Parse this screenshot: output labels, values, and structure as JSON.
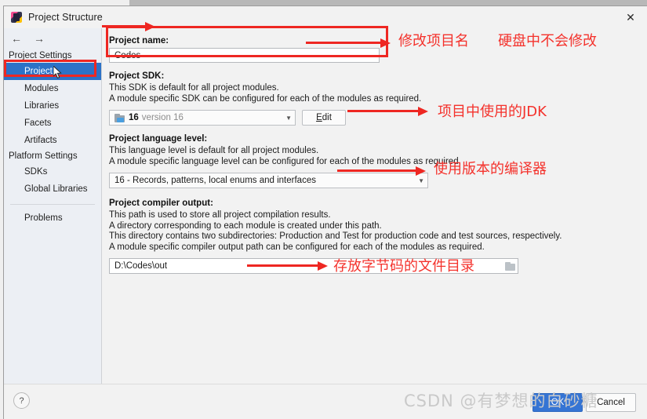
{
  "window": {
    "title": "Project Structure",
    "app_icon": "intellij-idea-icon",
    "close_label": "✕"
  },
  "sidebar": {
    "back_icon": "←",
    "forward_icon": "→",
    "groups": [
      {
        "label": "Project Settings",
        "items": [
          {
            "label": "Project",
            "selected": true
          },
          {
            "label": "Modules",
            "selected": false
          },
          {
            "label": "Libraries",
            "selected": false
          },
          {
            "label": "Facets",
            "selected": false
          },
          {
            "label": "Artifacts",
            "selected": false
          }
        ]
      },
      {
        "label": "Platform Settings",
        "items": [
          {
            "label": "SDKs",
            "selected": false
          },
          {
            "label": "Global Libraries",
            "selected": false
          }
        ]
      }
    ],
    "problems_label": "Problems"
  },
  "main": {
    "project_name": {
      "label": "Project name:",
      "value": "Codes"
    },
    "project_sdk": {
      "label": "Project SDK:",
      "desc_line1": "This SDK is default for all project modules.",
      "desc_line2": "A module specific SDK can be configured for each of the modules as required.",
      "sdk_number": "16",
      "sdk_version": "version 16",
      "caret": "▼",
      "edit_button_prefix": "",
      "edit_button_mnemonic": "E",
      "edit_button_suffix": "dit"
    },
    "language_level": {
      "label": "Project language level:",
      "desc_line1": "This language level is default for all project modules.",
      "desc_line2": "A module specific language level can be configured for each of the modules as required.",
      "value": "16 - Records, patterns, local enums and interfaces",
      "caret": "▼"
    },
    "compiler_output": {
      "label": "Project compiler output:",
      "desc_line1": "This path is used to store all project compilation results.",
      "desc_line2": "A directory corresponding to each module is created under this path.",
      "desc_line3": "This directory contains two subdirectories: Production and Test for production code and test sources, respectively.",
      "desc_line4": "A module specific compiler output path can be configured for each of the modules as required.",
      "value": "D:\\Codes\\out",
      "browse_icon": "folder-browse-icon"
    }
  },
  "footer": {
    "help_label": "?",
    "ok_label": "OK",
    "cancel_label": "Cancel"
  },
  "annotations": [
    {
      "id": "project-name-note",
      "text": "修改项目名"
    },
    {
      "id": "disk-note",
      "text": "硬盘中不会修改"
    },
    {
      "id": "jdk-note",
      "text": "项目中使用的JDK"
    },
    {
      "id": "compiler-version-note",
      "text": "使用版本的编译器"
    },
    {
      "id": "bytecode-dir-note",
      "text": "存放字节码的文件目录"
    }
  ],
  "watermark": {
    "text": "CSDN @有梦想的白砂糖"
  },
  "colors": {
    "selection_blue": "#2c72c7",
    "annotation_red": "#f4322c",
    "highlight_red": "#ee2722",
    "ok_button_blue": "#3574d4"
  }
}
